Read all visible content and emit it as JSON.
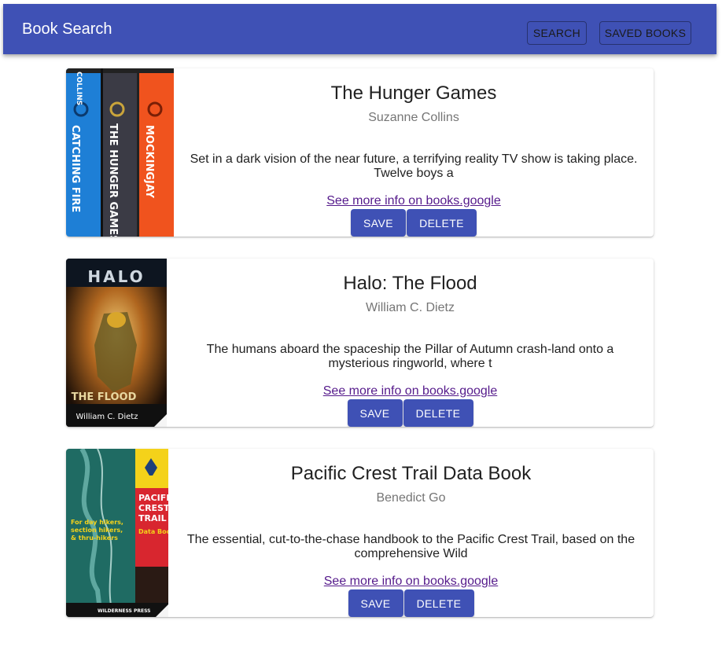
{
  "app": {
    "title": "Book Search",
    "nav": {
      "search_label": "SEARCH",
      "saved_label": "SAVED BOOKS"
    },
    "accent_color": "#3f51b5"
  },
  "books": [
    {
      "title": "The Hunger Games",
      "author": "Suzanne Collins",
      "description": "Set in a dark vision of the near future, a terrifying reality TV show is taking place. Twelve boys a",
      "link_text": "See more info on books.google",
      "save_label": "SAVE",
      "delete_label": "DELETE",
      "cover": {
        "spines": [
          "CATCHING FIRE",
          "THE HUNGER GAMES",
          "MOCKINGJAY"
        ],
        "author_text": "COLLINS"
      }
    },
    {
      "title": "Halo: The Flood",
      "author": "William C. Dietz",
      "description": "The humans aboard the spaceship the Pillar of Autumn crash-land onto a mysterious ringworld, where t",
      "link_text": "See more info on books.google",
      "save_label": "SAVE",
      "delete_label": "DELETE",
      "cover": {
        "brand": "HALO",
        "subtitle": "THE FLOOD",
        "author_text": "William C. Dietz"
      }
    },
    {
      "title": "Pacific Crest Trail Data Book",
      "author": "Benedict Go",
      "description": "The essential, cut-to-the-chase handbook to the Pacific Crest Trail, based on the comprehensive Wild",
      "link_text": "See more info on books.google",
      "save_label": "SAVE",
      "delete_label": "DELETE",
      "cover": {
        "title_lines": [
          "PACIFIC",
          "CREST",
          "TRAIL"
        ],
        "sub": "Data Book",
        "tagline_lines": [
          "For day hikers,",
          "section hikers,",
          "& thru-hikers"
        ],
        "publisher": "WILDERNESS PRESS"
      }
    }
  ]
}
